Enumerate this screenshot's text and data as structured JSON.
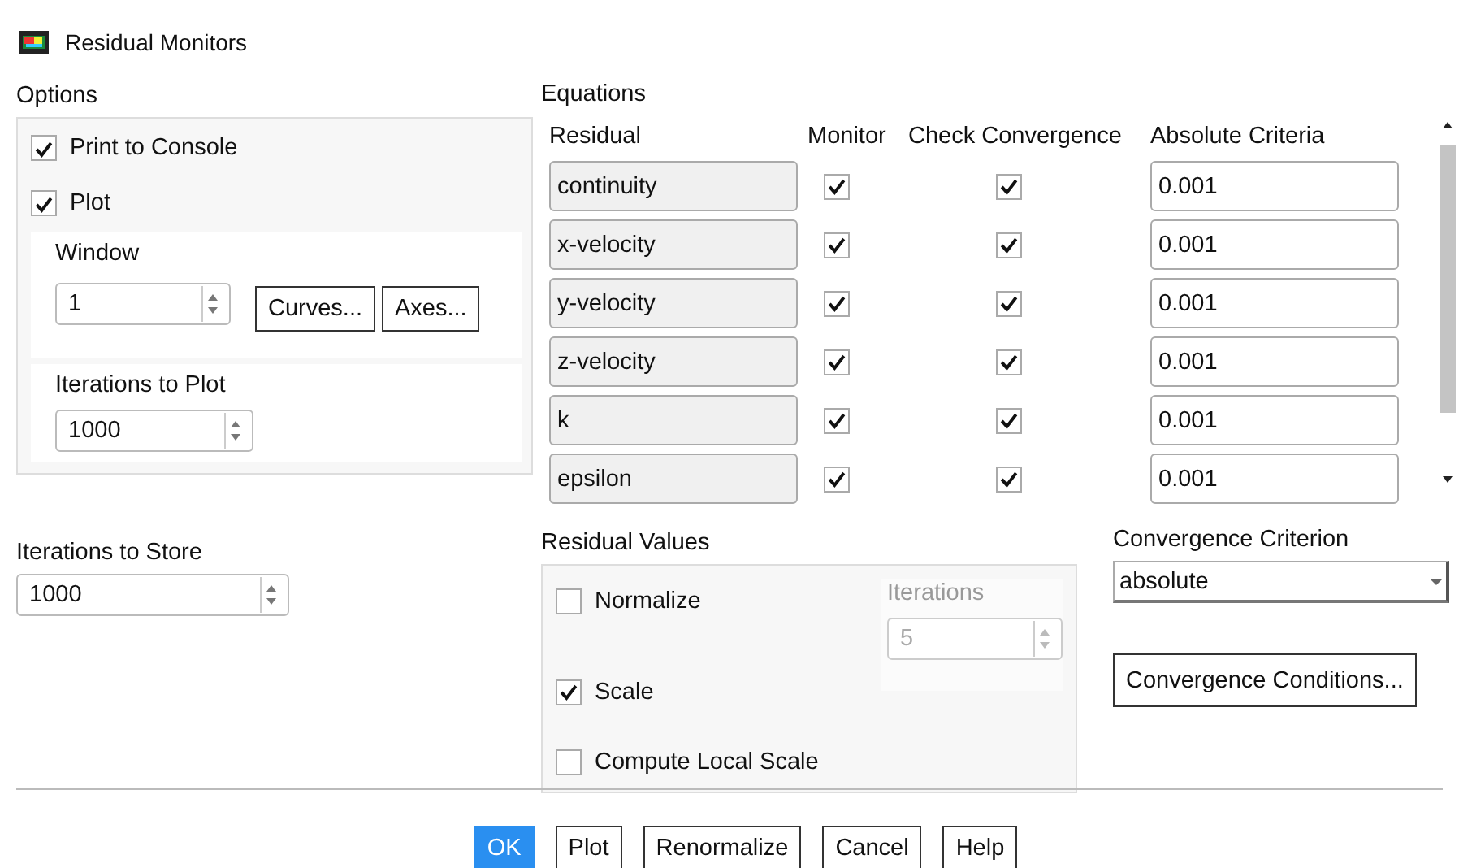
{
  "window": {
    "title": "Residual Monitors"
  },
  "options": {
    "label": "Options",
    "print_to_console": {
      "label": "Print to Console",
      "checked": true
    },
    "plot": {
      "label": "Plot",
      "checked": true
    },
    "window_label": "Window",
    "window_value": "1",
    "buttons": [
      "Curves...",
      "Axes..."
    ],
    "iterations_to_plot_label": "Iterations to Plot",
    "iterations_to_plot": "1000"
  },
  "equations": {
    "label": "Equations",
    "columns": [
      "Residual",
      "Monitor",
      "Check Convergence",
      "Absolute Criteria"
    ],
    "rows": [
      {
        "residual": "continuity",
        "monitor": true,
        "check_convergence": true,
        "criteria": "0.001"
      },
      {
        "residual": "x-velocity",
        "monitor": true,
        "check_convergence": true,
        "criteria": "0.001"
      },
      {
        "residual": "y-velocity",
        "monitor": true,
        "check_convergence": true,
        "criteria": "0.001"
      },
      {
        "residual": "z-velocity",
        "monitor": true,
        "check_convergence": true,
        "criteria": "0.001"
      },
      {
        "residual": "k",
        "monitor": true,
        "check_convergence": true,
        "criteria": "0.001"
      },
      {
        "residual": "epsilon",
        "monitor": true,
        "check_convergence": true,
        "criteria": "0.001"
      }
    ]
  },
  "iterations_to_store": {
    "label": "Iterations to Store",
    "value": "1000"
  },
  "residual_values": {
    "label": "Residual Values",
    "normalize": {
      "label": "Normalize",
      "checked": false
    },
    "iterations": {
      "label": "Iterations",
      "value": "5",
      "disabled": true
    },
    "scale": {
      "label": "Scale",
      "checked": true
    },
    "compute_local_scale": {
      "label": "Compute Local Scale",
      "checked": false
    }
  },
  "convergence_criterion": {
    "label": "Convergence Criterion",
    "value": "absolute"
  },
  "convergence_conditions_button": "Convergence Conditions...",
  "buttons": [
    {
      "label": "OK",
      "selected": true
    },
    {
      "label": "Plot",
      "selected": false
    },
    {
      "label": "Renormalize",
      "selected": false
    },
    {
      "label": "Cancel",
      "selected": false
    },
    {
      "label": "Help",
      "selected": false
    }
  ]
}
